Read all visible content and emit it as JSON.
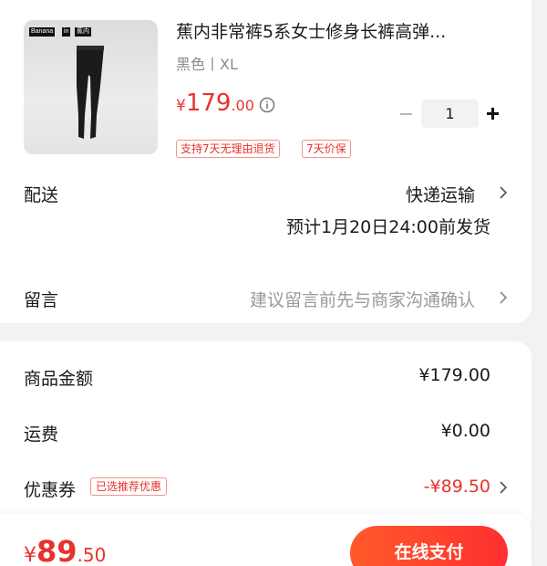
{
  "product": {
    "image_logo_1": "Banana",
    "image_logo_2": "in",
    "image_logo_3": "蕉内",
    "title": "蕉内非常裤5系女士修身长裤高弹...",
    "sku": "黑色丨XL",
    "price_symbol": "¥",
    "price_int": "179",
    "price_dec": ".00",
    "quantity": "1",
    "tags": [
      "支持7天无理由退货",
      "7天价保"
    ]
  },
  "delivery": {
    "label": "配送",
    "method": "快递运输",
    "estimate": "预计1月20日24:00前发货"
  },
  "message": {
    "label": "留言",
    "placeholder": "建议留言前先与商家沟通确认"
  },
  "summary": {
    "goods_label": "商品金额",
    "goods_value": "¥179.00",
    "shipping_label": "运费",
    "shipping_value": "¥0.00",
    "coupon_label": "优惠券",
    "coupon_badge": "已选推荐优惠",
    "coupon_value": "-¥89.50"
  },
  "footer": {
    "total_symbol": "¥",
    "total_int": "89",
    "total_dec": ".50",
    "pay_label": "在线支付"
  },
  "colors": {
    "accent": "#e8322c",
    "pay_gradient_start": "#ff5a2a",
    "pay_gradient_end": "#ff2f2f",
    "page_background": "#f2f2f4"
  }
}
